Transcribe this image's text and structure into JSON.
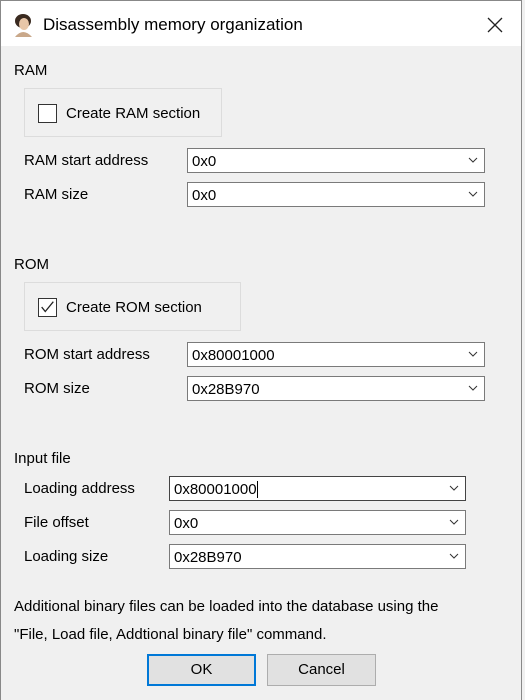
{
  "window": {
    "title": "Disassembly memory organization",
    "icon": "app-portrait-icon",
    "close_icon": "close-icon"
  },
  "ram": {
    "heading": "RAM",
    "create_label": "Create RAM section",
    "create_checked": false,
    "start_label": "RAM start address",
    "start_value": "0x0",
    "size_label": "RAM size",
    "size_value": "0x0"
  },
  "rom": {
    "heading": "ROM",
    "create_label": "Create ROM section",
    "create_checked": true,
    "start_label": "ROM start address",
    "start_value": "0x80001000",
    "size_label": "ROM size",
    "size_value": "0x28B970"
  },
  "input": {
    "heading": "Input file",
    "loading_address_label": "Loading address",
    "loading_address_value": "0x80001000",
    "file_offset_label": "File offset",
    "file_offset_value": "0x0",
    "loading_size_label": "Loading size",
    "loading_size_value": "0x28B970"
  },
  "note": {
    "line1": "Additional binary files can be loaded into the database using the",
    "line2": "\"File, Load file, Addtional binary file\" command."
  },
  "buttons": {
    "ok": "OK",
    "cancel": "Cancel"
  },
  "colors": {
    "accent": "#0078d7",
    "background": "#f0f0f0"
  }
}
